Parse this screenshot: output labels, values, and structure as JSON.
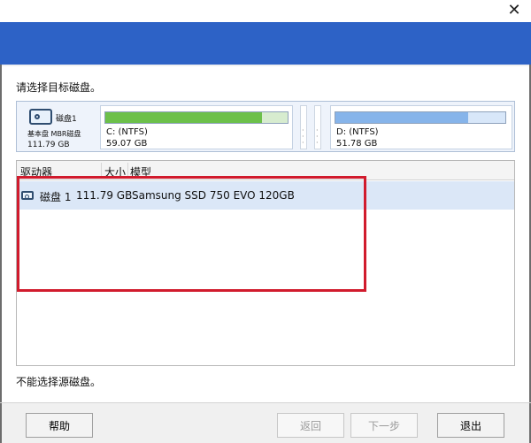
{
  "window": {
    "close_symbol": "✕"
  },
  "prompt": "请选择目标磁盘。",
  "disk_summary": {
    "name": "磁盘1",
    "type": "基本盘 MBR磁盘",
    "size": "111.79 GB"
  },
  "partitions": [
    {
      "label": "C: (NTFS)",
      "size": "59.07 GB",
      "used_fraction": 0.86,
      "color": "#6cc04a"
    },
    {
      "label": "D: (NTFS)",
      "size": "51.78 GB",
      "used_fraction": 0.78,
      "color": "#86b4ea"
    }
  ],
  "table": {
    "headers": {
      "drive": "驱动器",
      "size": "大小",
      "model": "模型"
    },
    "rows": [
      {
        "name": "磁盘 1",
        "size": "111.79 GB",
        "model": "Samsung SSD 750 EVO 120GB"
      }
    ]
  },
  "status": "不能选择源磁盘。",
  "buttons": {
    "help": "帮助",
    "back": "返回",
    "next": "下一步",
    "quit": "退出"
  },
  "colors": {
    "banner": "#2d62c6",
    "highlight": "#d11b2d"
  }
}
